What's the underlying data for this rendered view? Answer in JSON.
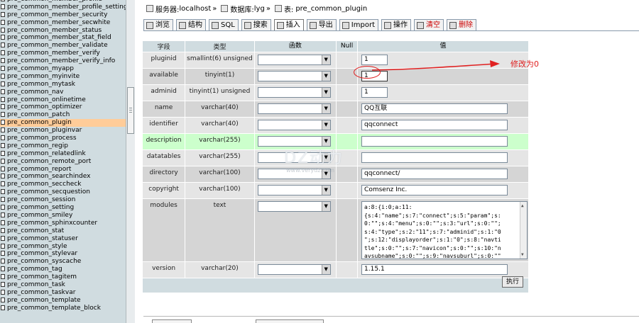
{
  "sidebar": {
    "items": [
      "pre_common_member_profile",
      "pre_common_member_profile_setting",
      "pre_common_member_security",
      "pre_common_member_secwhite",
      "pre_common_member_status",
      "pre_common_member_stat_field",
      "pre_common_member_validate",
      "pre_common_member_verify",
      "pre_common_member_verify_info",
      "pre_common_myapp",
      "pre_common_myinvite",
      "pre_common_mytask",
      "pre_common_nav",
      "pre_common_onlinetime",
      "pre_common_optimizer",
      "pre_common_patch",
      "pre_common_plugin",
      "pre_common_pluginvar",
      "pre_common_process",
      "pre_common_regip",
      "pre_common_relatedlink",
      "pre_common_remote_port",
      "pre_common_report",
      "pre_common_searchindex",
      "pre_common_seccheck",
      "pre_common_secquestion",
      "pre_common_session",
      "pre_common_setting",
      "pre_common_smiley",
      "pre_common_sphinxcounter",
      "pre_common_stat",
      "pre_common_statuser",
      "pre_common_style",
      "pre_common_stylevar",
      "pre_common_syscache",
      "pre_common_tag",
      "pre_common_tagitem",
      "pre_common_task",
      "pre_common_taskvar",
      "pre_common_template",
      "pre_common_template_block"
    ],
    "active_index": 16
  },
  "breadcrumb": {
    "server_label": "服务器:",
    "server_value": "localhost",
    "db_label": "数据库:",
    "db_value": "lyg",
    "table_label": "表:",
    "table_value": "pre_common_plugin",
    "sep": "»"
  },
  "tabs": [
    {
      "label": "浏览",
      "icon": "browse-icon"
    },
    {
      "label": "结构",
      "icon": "structure-icon"
    },
    {
      "label": "SQL",
      "icon": "sql-icon"
    },
    {
      "label": "搜索",
      "icon": "search-icon"
    },
    {
      "label": "插入",
      "icon": "insert-icon"
    },
    {
      "label": "导出",
      "icon": "export-icon"
    },
    {
      "label": "Import",
      "icon": "import-icon"
    },
    {
      "label": "操作",
      "icon": "operations-icon"
    },
    {
      "label": "清空",
      "icon": "empty-icon"
    },
    {
      "label": "删除",
      "icon": "drop-icon"
    }
  ],
  "active_tab": 4,
  "table": {
    "headers": {
      "field": "字段",
      "type": "类型",
      "function": "函数",
      "null": "Null",
      "value": "值"
    },
    "rows": [
      {
        "field": "pluginid",
        "type": "smallint(6) unsigned",
        "value": "1",
        "input": "short"
      },
      {
        "field": "available",
        "type": "tinyint(1)",
        "value": "1",
        "input": "short"
      },
      {
        "field": "adminid",
        "type": "tinyint(1) unsigned",
        "value": "1",
        "input": "short"
      },
      {
        "field": "name",
        "type": "varchar(40)",
        "value": "QQ互联",
        "input": "long"
      },
      {
        "field": "identifier",
        "type": "varchar(40)",
        "value": "qqconnect",
        "input": "long"
      },
      {
        "field": "description",
        "type": "varchar(255)",
        "value": "",
        "input": "long"
      },
      {
        "field": "datatables",
        "type": "varchar(255)",
        "value": "",
        "input": "long"
      },
      {
        "field": "directory",
        "type": "varchar(100)",
        "value": "qqconnect/",
        "input": "long"
      },
      {
        "field": "copyright",
        "type": "varchar(100)",
        "value": "Comsenz Inc.",
        "input": "long"
      },
      {
        "field": "modules",
        "type": "text",
        "value": "a:8:{i:0;a:11:\n{s:4:\"name\";s:7:\"connect\";s:5:\"param\";s:\n0:\"\";s:4:\"menu\";s:0:\"\";s:3:\"url\";s:0:\"\";\ns:4:\"type\";s:2:\"11\";s:7:\"adminid\";s:1:\"0\n\";s:12:\"displayorder\";s:1:\"0\";s:8:\"navti\ntle\";s:0:\"\";s:7:\"navicon\";s:0:\"\";s:10:\"n\navsubname\";s:0:\"\";s:9:\"navsuburl\";s:0:\"\"",
        "input": "textarea"
      },
      {
        "field": "version",
        "type": "varchar(20)",
        "value": "1.15.1",
        "input": "long"
      }
    ],
    "go_label": "执行"
  },
  "annotation": {
    "text": "修改为0",
    "color": "#e02020"
  },
  "watermark": {
    "main": "DZ动力",
    "sub": "www.verydz.com"
  },
  "colors": {
    "sidebar_bg": "#d0dce0",
    "row_a": "#e5e5e5",
    "row_b": "#d5d5d5",
    "row_highlight": "#ccffcc",
    "active_item": "#ffcc99"
  }
}
